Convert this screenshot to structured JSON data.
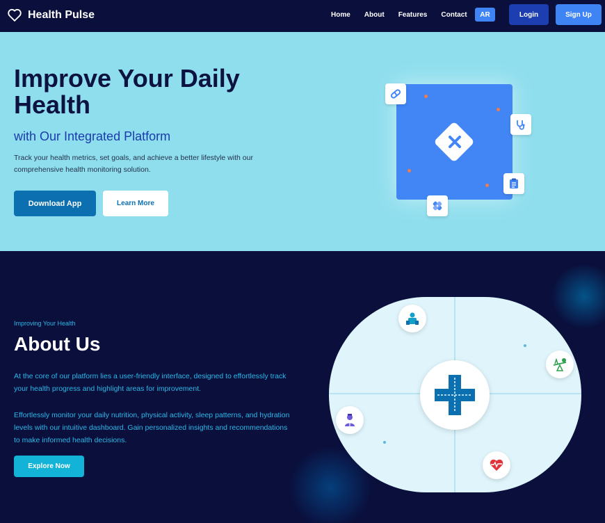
{
  "brand": {
    "name": "Health Pulse",
    "icon": "heart-outline-icon"
  },
  "nav": {
    "links": [
      "Home",
      "About",
      "Features",
      "Contact"
    ],
    "lang": "AR",
    "login": "Login",
    "signup": "Sign Up"
  },
  "hero": {
    "title": "Improve Your Daily Health",
    "subtitle": "with Our Integrated Platform",
    "description": "Track your health metrics, set goals, and achieve a better lifestyle with our comprehensive health monitoring solution.",
    "download_label": "Download App",
    "learn_label": "Learn More",
    "icons": [
      "pill-icon",
      "stethoscope-icon",
      "clipboard-icon",
      "bandage-icon",
      "medical-x-icon"
    ]
  },
  "about": {
    "kicker": "Improving Your Health",
    "title": "About Us",
    "paragraph1": "At the core of our platform lies a user-friendly interface, designed to effortlessly track your health progress and highlight areas for improvement.",
    "paragraph2": "Effortlessly monitor your daily nutrition, physical activity, sleep patterns, and hydration levels with our intuitive dashboard. Gain personalized insights and recommendations to make informed health decisions.",
    "explore_label": "Explore Now",
    "icons": [
      "health-cross-icon",
      "healthcare-worker-icon",
      "balance-nutrition-icon",
      "doctor-icon",
      "heartbeat-icon"
    ]
  },
  "colors": {
    "navy": "#0a0f3c",
    "hero_bg": "#8fdeee",
    "primary_blue": "#3f84f4",
    "accent_cyan": "#2ab8e8"
  }
}
